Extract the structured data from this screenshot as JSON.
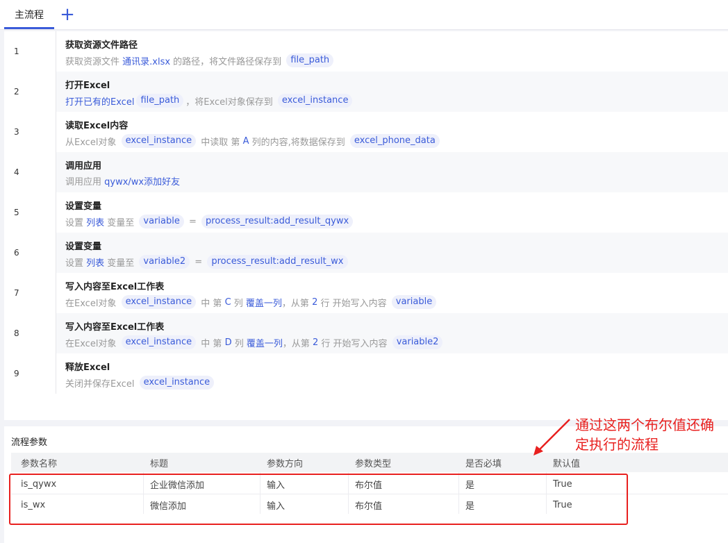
{
  "tabs": {
    "main_label": "主流程",
    "add_label": "+"
  },
  "steps": [
    {
      "num": "1",
      "title": "获取资源文件路径",
      "desc": [
        {
          "k": "t",
          "v": "获取资源文件 "
        },
        {
          "k": "b",
          "v": "通讯录.xlsx"
        },
        {
          "k": "t",
          "v": " 的路径，将文件路径保存到 "
        },
        {
          "k": "p",
          "v": "file_path"
        }
      ]
    },
    {
      "num": "2",
      "title": "打开Excel",
      "desc": [
        {
          "k": "b",
          "v": "打开已有的Excel"
        },
        {
          "k": "p",
          "v": "file_path"
        },
        {
          "k": "t",
          "v": "，将Excel对象保存到 "
        },
        {
          "k": "p",
          "v": "excel_instance"
        }
      ]
    },
    {
      "num": "3",
      "title": "读取Excel内容",
      "desc": [
        {
          "k": "t",
          "v": "从Excel对象 "
        },
        {
          "k": "p",
          "v": "excel_instance"
        },
        {
          "k": "t",
          "v": " 中读取 第 "
        },
        {
          "k": "b",
          "v": "A"
        },
        {
          "k": "t",
          "v": " 列的内容,将数据保存到 "
        },
        {
          "k": "p",
          "v": "excel_phone_data"
        }
      ]
    },
    {
      "num": "4",
      "title": "调用应用",
      "desc": [
        {
          "k": "t",
          "v": "调用应用 "
        },
        {
          "k": "b",
          "v": "qywx/wx添加好友"
        }
      ]
    },
    {
      "num": "5",
      "title": "设置变量",
      "desc": [
        {
          "k": "t",
          "v": "设置 "
        },
        {
          "k": "b",
          "v": "列表"
        },
        {
          "k": "t",
          "v": " 变量至 "
        },
        {
          "k": "p",
          "v": "variable"
        },
        {
          "k": "t",
          "v": " = "
        },
        {
          "k": "p",
          "v": "process_result:add_result_qywx"
        }
      ]
    },
    {
      "num": "6",
      "title": "设置变量",
      "desc": [
        {
          "k": "t",
          "v": "设置 "
        },
        {
          "k": "b",
          "v": "列表"
        },
        {
          "k": "t",
          "v": " 变量至 "
        },
        {
          "k": "p",
          "v": "variable2"
        },
        {
          "k": "t",
          "v": " = "
        },
        {
          "k": "p",
          "v": "process_result:add_result_wx"
        }
      ]
    },
    {
      "num": "7",
      "title": "写入内容至Excel工作表",
      "desc": [
        {
          "k": "t",
          "v": "在Excel对象 "
        },
        {
          "k": "p",
          "v": "excel_instance"
        },
        {
          "k": "t",
          "v": " 中 第 "
        },
        {
          "k": "b",
          "v": "C"
        },
        {
          "k": "t",
          "v": " 列 "
        },
        {
          "k": "b",
          "v": "覆盖一列"
        },
        {
          "k": "t",
          "v": "，从第 "
        },
        {
          "k": "b",
          "v": "2"
        },
        {
          "k": "t",
          "v": " 行 开始写入内容 "
        },
        {
          "k": "p",
          "v": "variable"
        }
      ]
    },
    {
      "num": "8",
      "title": "写入内容至Excel工作表",
      "desc": [
        {
          "k": "t",
          "v": "在Excel对象 "
        },
        {
          "k": "p",
          "v": "excel_instance"
        },
        {
          "k": "t",
          "v": " 中 第 "
        },
        {
          "k": "b",
          "v": "D"
        },
        {
          "k": "t",
          "v": " 列 "
        },
        {
          "k": "b",
          "v": "覆盖一列"
        },
        {
          "k": "t",
          "v": "，从第 "
        },
        {
          "k": "b",
          "v": "2"
        },
        {
          "k": "t",
          "v": " 行 开始写入内容 "
        },
        {
          "k": "p",
          "v": "variable2"
        }
      ]
    },
    {
      "num": "9",
      "title": "释放Excel",
      "desc": [
        {
          "k": "t",
          "v": "关闭并保存Excel "
        },
        {
          "k": "p",
          "v": "excel_instance"
        }
      ]
    }
  ],
  "params": {
    "title": "流程参数",
    "columns": [
      "参数名称",
      "标题",
      "参数方向",
      "参数类型",
      "是否必填",
      "默认值"
    ],
    "rows": [
      [
        "is_qywx",
        "企业微信添加",
        "输入",
        "布尔值",
        "是",
        "True"
      ],
      [
        "is_wx",
        "微信添加",
        "输入",
        "布尔值",
        "是",
        "True"
      ]
    ]
  },
  "annotation": {
    "text": "通过这两个布尔值还确定执行的流程",
    "color": "#e8201f"
  },
  "colors": {
    "accent": "#3a5bd9",
    "pill_bg": "#eef0fb",
    "annotation": "#e8201f"
  }
}
